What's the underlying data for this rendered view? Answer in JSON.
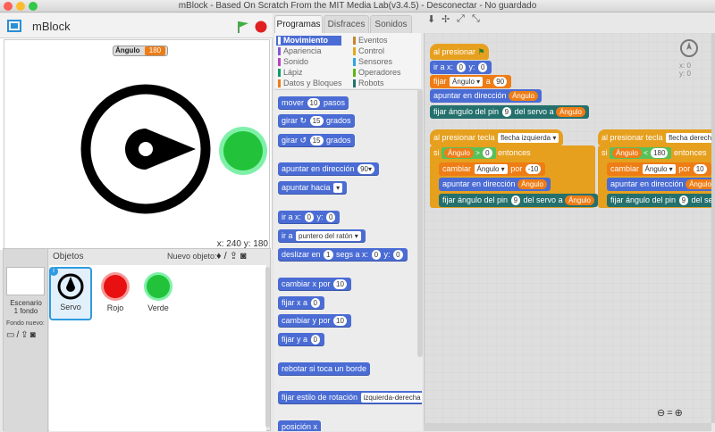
{
  "window": {
    "title": "mBlock - Based On Scratch From the MIT Media Lab(v3.4.5) - Desconectar - No guardado"
  },
  "app": {
    "name": "mBlock"
  },
  "stage": {
    "variable_monitor": {
      "label": "Ángulo",
      "value": "180"
    },
    "coords_label": "x: 240  y: 180"
  },
  "sprites": {
    "header": "Objetos",
    "new_object_label": "Nuevo objeto:",
    "stage_name": "Escenario",
    "stage_backdrops": "1 fondo",
    "new_backdrop_label": "Fondo nuevo:",
    "items": [
      {
        "name": "Servo"
      },
      {
        "name": "Rojo"
      },
      {
        "name": "Verde"
      }
    ]
  },
  "tabs": [
    {
      "label": "Programas"
    },
    {
      "label": "Disfraces"
    },
    {
      "label": "Sonidos"
    }
  ],
  "categories": {
    "left": [
      {
        "label": "Movimiento",
        "color": "#4a6cd4"
      },
      {
        "label": "Apariencia",
        "color": "#8a55d7"
      },
      {
        "label": "Sonido",
        "color": "#bb42c3"
      },
      {
        "label": "Lápiz",
        "color": "#0e9a6c"
      },
      {
        "label": "Datos y Bloques",
        "color": "#ee7d16"
      }
    ],
    "right": [
      {
        "label": "Eventos",
        "color": "#c88330"
      },
      {
        "label": "Control",
        "color": "#e1a91a"
      },
      {
        "label": "Sensores",
        "color": "#2ca5e2"
      },
      {
        "label": "Operadores",
        "color": "#5cb712"
      },
      {
        "label": "Robots",
        "color": "#24706d"
      }
    ]
  },
  "palette": {
    "move": {
      "pre": "mover",
      "num": "10",
      "post": "pasos"
    },
    "turn_right": {
      "pre": "girar",
      "num": "15",
      "post": "grados"
    },
    "turn_left": {
      "pre": "girar",
      "num": "15",
      "post": "grados"
    },
    "point_dir": {
      "pre": "apuntar en dirección",
      "num": "90▾"
    },
    "point_towards": {
      "pre": "apuntar hacia",
      "drop": "▾"
    },
    "goto_xy": {
      "pre": "ir a x:",
      "x": "0",
      "mid": "y:",
      "y": "0"
    },
    "goto": {
      "pre": "ir a",
      "drop": "puntero del ratón ▾"
    },
    "glide": {
      "pre": "deslizar en",
      "secs": "1",
      "mid": "segs a x:",
      "x": "0",
      "mid2": "y:",
      "y": "0"
    },
    "change_x": {
      "pre": "cambiar x por",
      "num": "10"
    },
    "set_x": {
      "pre": "fijar x a",
      "num": "0"
    },
    "change_y": {
      "pre": "cambiar y por",
      "num": "10"
    },
    "set_y": {
      "pre": "fijar y a",
      "num": "0"
    },
    "bounce": {
      "label": "rebotar si toca un borde"
    },
    "rotation": {
      "pre": "fijar estilo de rotación",
      "drop": "izquierda-derecha ▾"
    },
    "position": {
      "label": "posición x"
    }
  },
  "scripts": {
    "s1": {
      "hat": "al presionar",
      "goto": {
        "pre": "ir a x:",
        "x": "0",
        "mid": "y:",
        "y": "0"
      },
      "set_var": {
        "pre": "fijar",
        "var": "Ángulo ▾",
        "mid": "a",
        "val": "90"
      },
      "point": {
        "pre": "apuntar en dirección",
        "var": "Ángulo"
      },
      "servo": {
        "pre": "fijar ángulo del pin",
        "pin": "9",
        "mid": "del servo a",
        "var": "Ángulo"
      }
    },
    "s2": {
      "hat": "al presionar tecla",
      "key": "flecha izquierda ▾",
      "if": {
        "pre": "si",
        "var": "Ángulo",
        "op": ">",
        "val": "0",
        "post": "entonces"
      },
      "change": {
        "pre": "cambiar",
        "var": "Ángulo ▾",
        "mid": "por",
        "val": "-10"
      },
      "point": {
        "pre": "apuntar en dirección",
        "var": "Ángulo"
      },
      "servo": {
        "pre": "fijar ángulo del pin",
        "pin": "9",
        "mid": "del servo a",
        "var": "Ángulo"
      }
    },
    "s3": {
      "hat": "al presionar tecla",
      "key": "flecha derecha",
      "if": {
        "pre": "si",
        "var": "Ángulo",
        "op": "<",
        "val": "180",
        "post": "entonces"
      },
      "change": {
        "pre": "cambiar",
        "var": "Ángulo ▾",
        "mid": "por",
        "val": "10"
      },
      "point": {
        "pre": "apuntar en dirección",
        "var": "Ángulo"
      },
      "servo": {
        "pre": "fijar ángulo del pin",
        "pin": "9",
        "mid": "del servo a"
      }
    },
    "readout": {
      "x": "x: 0",
      "y": "y: 0"
    }
  }
}
